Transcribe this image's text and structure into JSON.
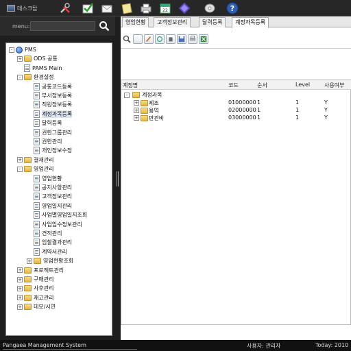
{
  "toolbar": {
    "home_label": "데스크탑",
    "icons": [
      "tools-icon",
      "check-icon",
      "mail-icon",
      "note-icon",
      "printer-icon",
      "calendar-icon",
      "diamond-icon",
      "tag-icon",
      "help-icon"
    ],
    "calendar_num": "22"
  },
  "menu": {
    "label": "menu:",
    "search_value": ""
  },
  "tree": [
    {
      "label": "PMS",
      "level": 0,
      "type": "globe",
      "exp": "-"
    },
    {
      "label": "ODS 공통",
      "level": 1,
      "type": "folder",
      "exp": "+"
    },
    {
      "label": "PAMS Main",
      "level": 1,
      "type": "page",
      "exp": ""
    },
    {
      "label": "환경설정",
      "level": 1,
      "type": "folder",
      "exp": "-"
    },
    {
      "label": "공통코드등록",
      "level": 2,
      "type": "page",
      "exp": ""
    },
    {
      "label": "부서정보등록",
      "level": 2,
      "type": "page",
      "exp": ""
    },
    {
      "label": "직원정보등록",
      "level": 2,
      "type": "page",
      "exp": ""
    },
    {
      "label": "계정과목등록",
      "level": 2,
      "type": "page",
      "exp": "",
      "selected": true
    },
    {
      "label": "달력등록",
      "level": 2,
      "type": "page",
      "exp": ""
    },
    {
      "label": "권한그룹관리",
      "level": 2,
      "type": "page",
      "exp": ""
    },
    {
      "label": "권한관리",
      "level": 2,
      "type": "page",
      "exp": ""
    },
    {
      "label": "개인정보수정",
      "level": 2,
      "type": "page",
      "exp": ""
    },
    {
      "label": "결재관리",
      "level": 1,
      "type": "folder",
      "exp": "+"
    },
    {
      "label": "영업관리",
      "level": 1,
      "type": "folder",
      "exp": "-"
    },
    {
      "label": "영업현황",
      "level": 2,
      "type": "page",
      "exp": ""
    },
    {
      "label": "공지사항관리",
      "level": 2,
      "type": "page",
      "exp": ""
    },
    {
      "label": "고객정보관리",
      "level": 2,
      "type": "page",
      "exp": ""
    },
    {
      "label": "영업일지관리",
      "level": 2,
      "type": "page",
      "exp": ""
    },
    {
      "label": "사업별영업일지조회",
      "level": 2,
      "type": "page",
      "exp": ""
    },
    {
      "label": "사업입수정보관리",
      "level": 2,
      "type": "page",
      "exp": ""
    },
    {
      "label": "견적관리",
      "level": 2,
      "type": "page",
      "exp": ""
    },
    {
      "label": "입찰결과관리",
      "level": 2,
      "type": "page",
      "exp": ""
    },
    {
      "label": "계약서관리",
      "level": 2,
      "type": "page",
      "exp": ""
    },
    {
      "label": "영업현황조회",
      "level": 2,
      "type": "folder",
      "exp": "+"
    },
    {
      "label": "프로젝트관리",
      "level": 1,
      "type": "folder",
      "exp": "+"
    },
    {
      "label": "구매관리",
      "level": 1,
      "type": "folder",
      "exp": "+"
    },
    {
      "label": "사후관리",
      "level": 1,
      "type": "folder",
      "exp": "+"
    },
    {
      "label": "재고관리",
      "level": 1,
      "type": "folder",
      "exp": "+"
    },
    {
      "label": "데모/시연",
      "level": 1,
      "type": "folder",
      "exp": "+"
    }
  ],
  "tabs": [
    "영업현황",
    "고객정보관리",
    "달력등록",
    "계정과목등록"
  ],
  "active_tab": 3,
  "grid": {
    "headers": [
      "계정명",
      "코드",
      "순서",
      "Level",
      "사용여부"
    ],
    "root": "계정과목",
    "rows": [
      {
        "name": "제조",
        "code": "01000000",
        "order": "1",
        "level": "1",
        "use": "Y"
      },
      {
        "name": "용역",
        "code": "02000000",
        "order": "1",
        "level": "1",
        "use": "Y"
      },
      {
        "name": "판관비",
        "code": "03000000",
        "order": "1",
        "level": "1",
        "use": "Y"
      }
    ]
  },
  "status": {
    "app_name": "Pangaea Management System",
    "user": "사용자: 관리자",
    "today": "Today:  2010"
  }
}
